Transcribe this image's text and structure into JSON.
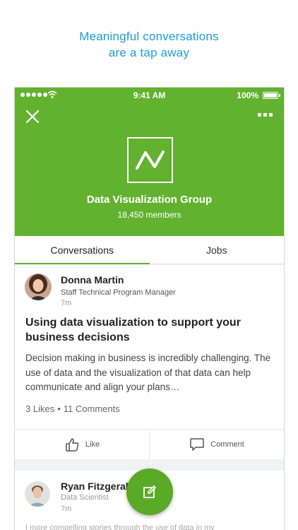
{
  "tagline": {
    "line1": "Meaningful conversations",
    "line2": "are a tap away"
  },
  "status_bar": {
    "time": "9:41 AM",
    "battery": "100%"
  },
  "group": {
    "name": "Data Visualization Group",
    "members": "18,450 members"
  },
  "tabs": [
    {
      "label": "Conversations",
      "active": true
    },
    {
      "label": "Jobs",
      "active": false
    }
  ],
  "posts": [
    {
      "author": "Donna Martin",
      "role": "Staff Technical Program Manager",
      "time": "7m",
      "title": "Using data visualization to support your business decisions",
      "body": "Decision making in business is incredibly challenging. The use of data and the visualization of that data can help communicate and align your plans…",
      "likes": "3 Likes",
      "comments": "11 Comments",
      "like_label": "Like",
      "comment_label": "Comment"
    },
    {
      "author": "Ryan Fitzgerald",
      "role": "Data Scientist",
      "time": "7m",
      "snippet": "I more compelling stories through the use of data in my"
    }
  ],
  "colors": {
    "brand_green": "#62b22f",
    "tagline_blue": "#1a9fd6"
  },
  "icons": [
    "close-icon",
    "more-icon",
    "group-logo-icon",
    "like-icon",
    "comment-icon",
    "compose-icon"
  ]
}
